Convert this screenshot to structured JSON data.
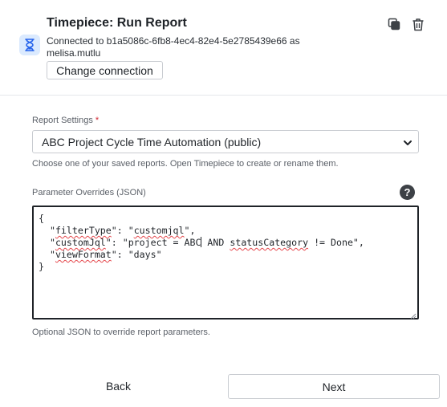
{
  "header": {
    "title": "Timepiece: Run Report",
    "connection_text": "Connected to b1a5086c-6fb8-4ec4-82e4-5e2785439e66 as",
    "connection_user": "melisa.mutlu",
    "change_connection_label": "Change connection",
    "icons": {
      "app": "hourglass-icon",
      "copy": "copy-icon",
      "delete": "trash-icon"
    },
    "accent_color": "#2563eb"
  },
  "report_settings": {
    "label": "Report Settings",
    "required_mark": "*",
    "selected_value": "ABC Project Cycle Time Automation (public)",
    "hint": "Choose one of your saved reports. Open Timepiece to create or rename them."
  },
  "parameter_overrides": {
    "label": "Parameter Overrides (JSON)",
    "help_icon": "?",
    "code_lines": [
      "{",
      "  \"filterType\": \"customjql\",",
      "  \"customJql\": \"project = ABC AND statusCategory != Done\",",
      "  \"viewFormat\": \"days\"",
      "}"
    ],
    "hint": "Optional JSON to override report parameters."
  },
  "footer": {
    "back_label": "Back",
    "next_label": "Next"
  }
}
